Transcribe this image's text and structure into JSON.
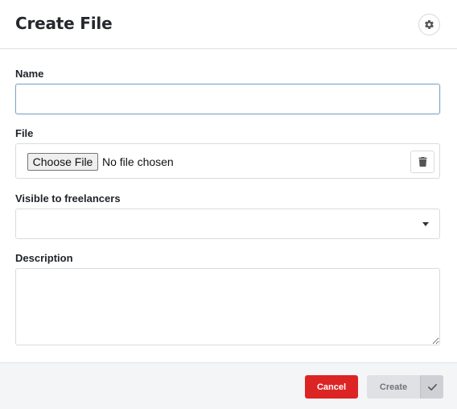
{
  "header": {
    "title": "Create File",
    "settings_icon": "gear-icon"
  },
  "form": {
    "name": {
      "label": "Name",
      "value": "",
      "placeholder": ""
    },
    "file": {
      "label": "File",
      "choose_button_label": "Choose File",
      "status_text": "No file chosen",
      "remove_icon": "trash-icon"
    },
    "visible": {
      "label": "Visible to freelancers",
      "selected_value": "",
      "dropdown_icon": "caret-down-icon"
    },
    "description": {
      "label": "Description",
      "value": ""
    }
  },
  "footer": {
    "cancel_label": "Cancel",
    "create_label": "Create",
    "confirm_icon": "check-icon"
  },
  "colors": {
    "danger": "#dc2424",
    "focus_border": "#7fa7c8",
    "disabled_button": "#dfe1e5"
  }
}
